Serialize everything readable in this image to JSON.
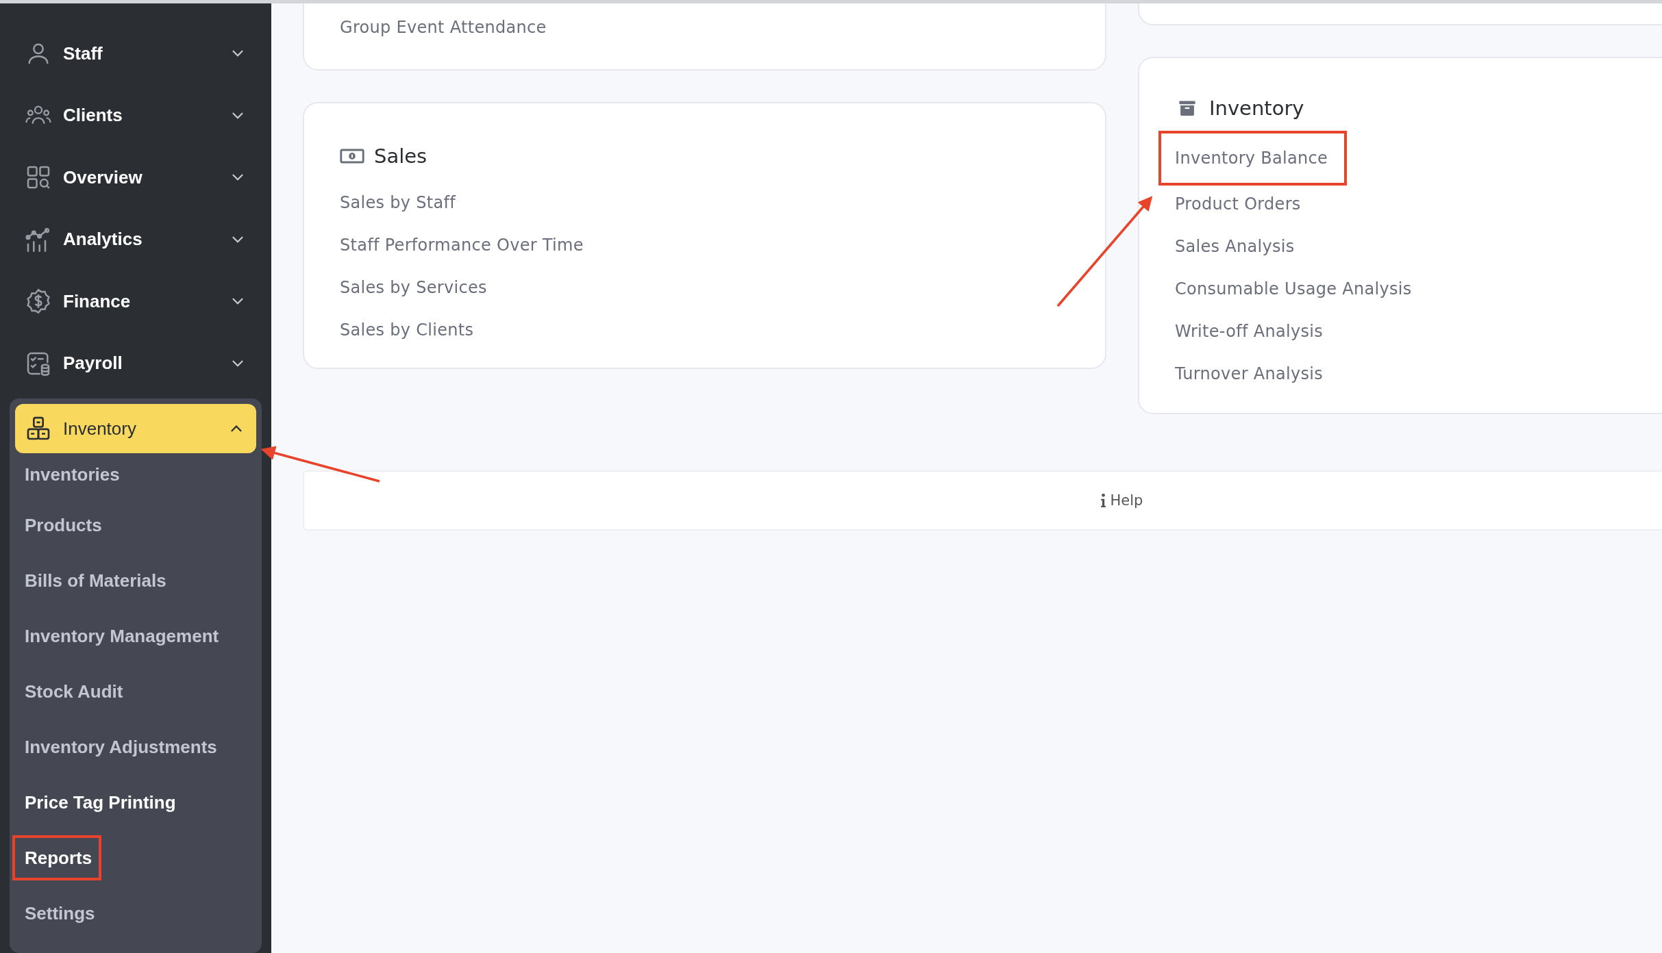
{
  "sidebar": {
    "items": [
      {
        "label": "Staff",
        "expanded": false
      },
      {
        "label": "Clients",
        "expanded": false
      },
      {
        "label": "Overview",
        "expanded": false
      },
      {
        "label": "Analytics",
        "expanded": false
      },
      {
        "label": "Finance",
        "expanded": false
      },
      {
        "label": "Payroll",
        "expanded": false
      },
      {
        "label": "Inventory",
        "expanded": true,
        "children": [
          {
            "label": "Inventories",
            "selected": false,
            "hovered": false,
            "annotated": false
          },
          {
            "label": "Products",
            "selected": false,
            "hovered": false,
            "annotated": false
          },
          {
            "label": "Bills of Materials",
            "selected": false,
            "hovered": false,
            "annotated": false
          },
          {
            "label": "Inventory Management",
            "selected": false,
            "hovered": false,
            "annotated": false
          },
          {
            "label": "Stock Audit",
            "selected": false,
            "hovered": false,
            "annotated": false
          },
          {
            "label": "Inventory Adjustments",
            "selected": false,
            "hovered": false,
            "annotated": false
          },
          {
            "label": "Price Tag Printing",
            "selected": false,
            "hovered": true,
            "annotated": false
          },
          {
            "label": "Reports",
            "selected": true,
            "hovered": false,
            "annotated": true
          },
          {
            "label": "Settings",
            "selected": false,
            "hovered": false,
            "annotated": false
          }
        ]
      }
    ]
  },
  "report_groups": {
    "left": [
      {
        "cut": true,
        "links": [
          {
            "label": "Group Event Attendance",
            "annotated": false
          }
        ]
      },
      {
        "title": "Sales",
        "cut": false,
        "links": [
          {
            "label": "Sales by Staff",
            "annotated": false
          },
          {
            "label": "Staff Performance Over Time",
            "annotated": false
          },
          {
            "label": "Sales by Services",
            "annotated": false
          },
          {
            "label": "Sales by Clients",
            "annotated": false
          }
        ]
      }
    ],
    "right": [
      {
        "cut": true
      },
      {
        "title": "Inventory",
        "cut": false,
        "links": [
          {
            "label": "Inventory Balance",
            "annotated": true
          },
          {
            "label": "Product Orders",
            "annotated": false
          },
          {
            "label": "Sales Analysis",
            "annotated": false
          },
          {
            "label": "Consumable Usage Analysis",
            "annotated": false
          },
          {
            "label": "Write-off Analysis",
            "annotated": false
          },
          {
            "label": "Turnover Analysis",
            "annotated": false
          }
        ]
      }
    ]
  },
  "footer": {
    "help": "Help"
  }
}
